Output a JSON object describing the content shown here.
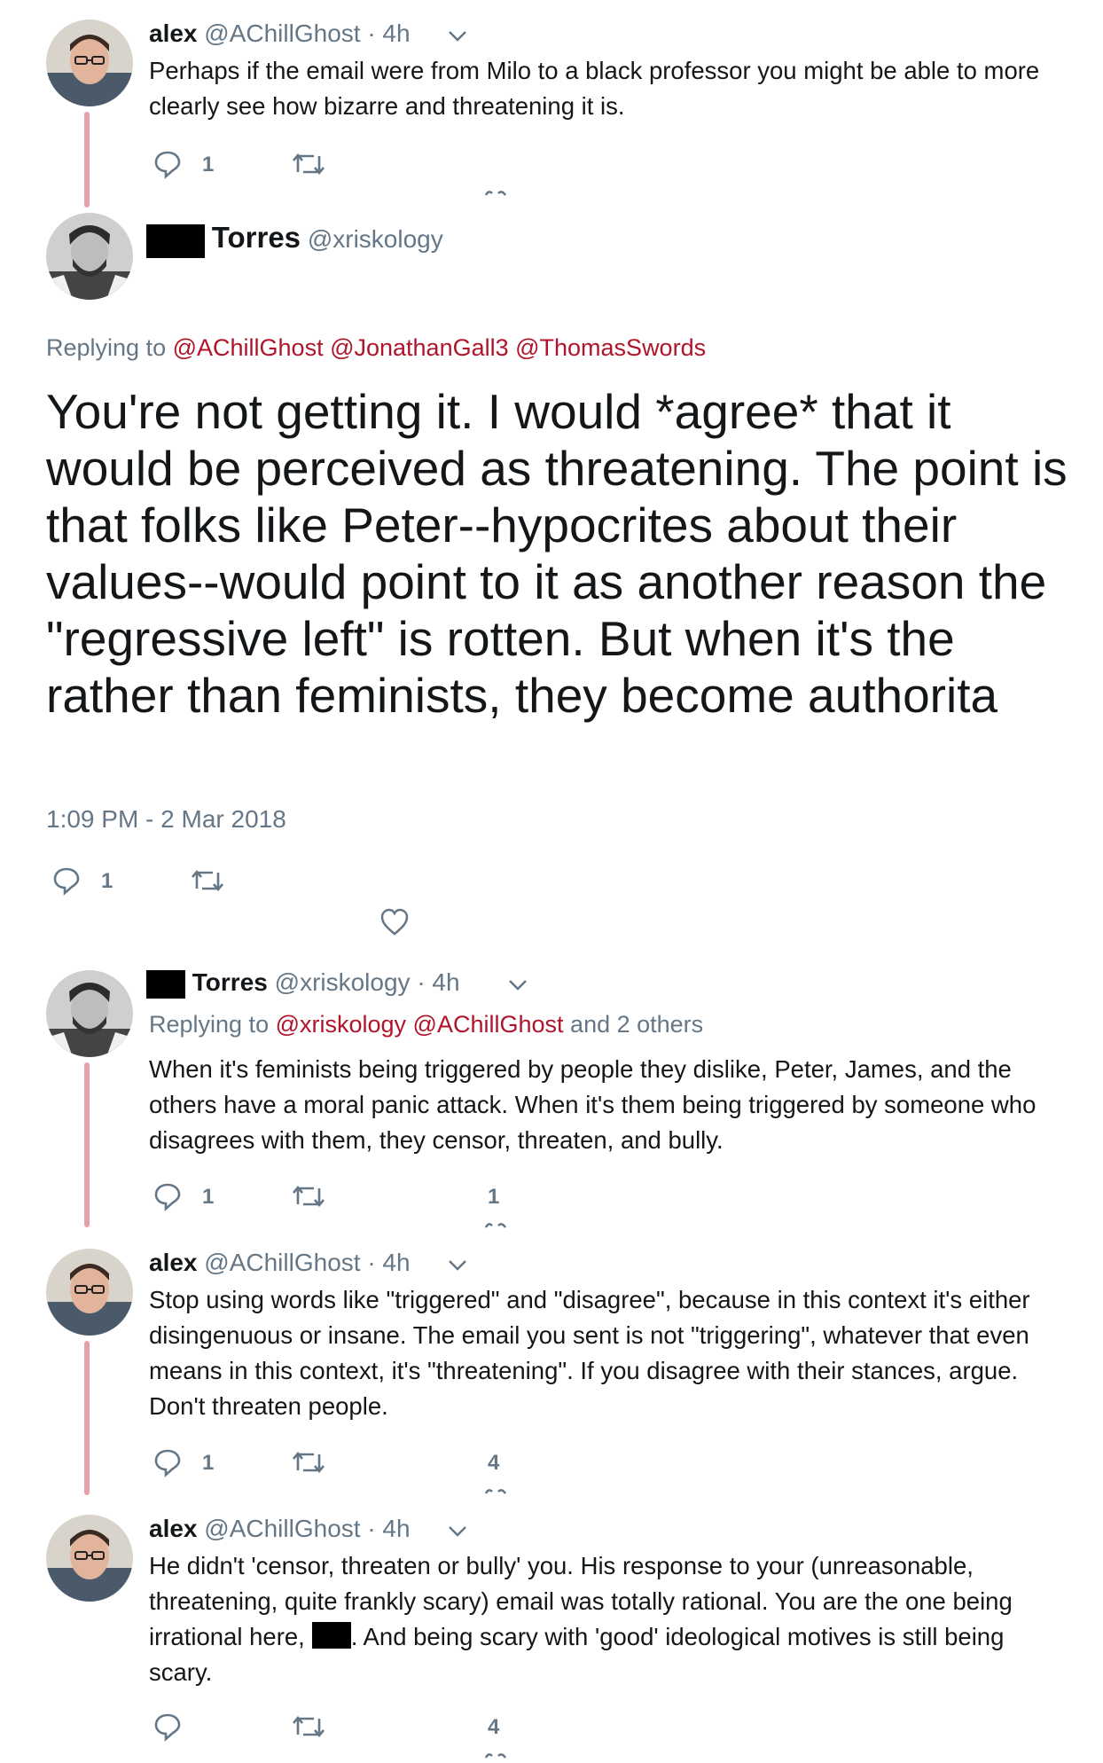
{
  "tweet1": {
    "name": "alex",
    "handle": "@AChillGhost",
    "time": "· 4h",
    "text": "Perhaps if the email were from Milo to a black professor you might be able to more clearly see how bizarre and threatening it is.",
    "reply_count": "1"
  },
  "main_tweet": {
    "name": "Torres",
    "handle": "@xriskology",
    "replying_prefix": "Replying to",
    "mentions": "@AChillGhost @JonathanGall3 @ThomasSwords",
    "text": "You're not getting it. I would *agree* that it would be perceived as threatening. The point is that folks like Peter--hypocrites about their values--would point to it as another reason the \"regressive left\" is rotten. But when it's the rather than feminists, they become authorita",
    "timestamp": "1:09 PM - 2 Mar 2018",
    "reply_count": "1"
  },
  "tweet3": {
    "name": "Torres",
    "handle": "@xriskology",
    "time": "· 4h",
    "replying_prefix": "Replying to",
    "mentions": "@xriskology @AChillGhost",
    "replying_suffix": "and 2 others",
    "text": "When it's feminists being triggered by people they dislike, Peter, James, and the others have a moral panic attack. When it's them being triggered by someone who disagrees with them, they censor, threaten, and bully.",
    "reply_count": "1",
    "like_count": "1"
  },
  "tweet4": {
    "name": "alex",
    "handle": "@AChillGhost",
    "time": "· 4h",
    "text": "Stop using words like \"triggered\" and \"disagree\", because in this context it's either disingenuous or insane. The email you sent is not \"triggering\", whatever that even means in this context, it's \"threatening\". If you disagree with their stances, argue. Don't threaten people.",
    "reply_count": "1",
    "like_count": "4"
  },
  "tweet5": {
    "name": "alex",
    "handle": "@AChillGhost",
    "time": "· 4h",
    "text_before": "He didn't 'censor, threaten or bully' you. His response to your (unreasonable, threatening, quite frankly scary) email was totally rational. You are the one being irrational here,",
    "text_after": ". And being scary with 'good' ideological motives is still being scary.",
    "like_count": "4"
  },
  "colors": {
    "text": "#14171a",
    "secondary": "#657786",
    "mention": "#b0142a",
    "thread_line": "#e6a1a8"
  }
}
